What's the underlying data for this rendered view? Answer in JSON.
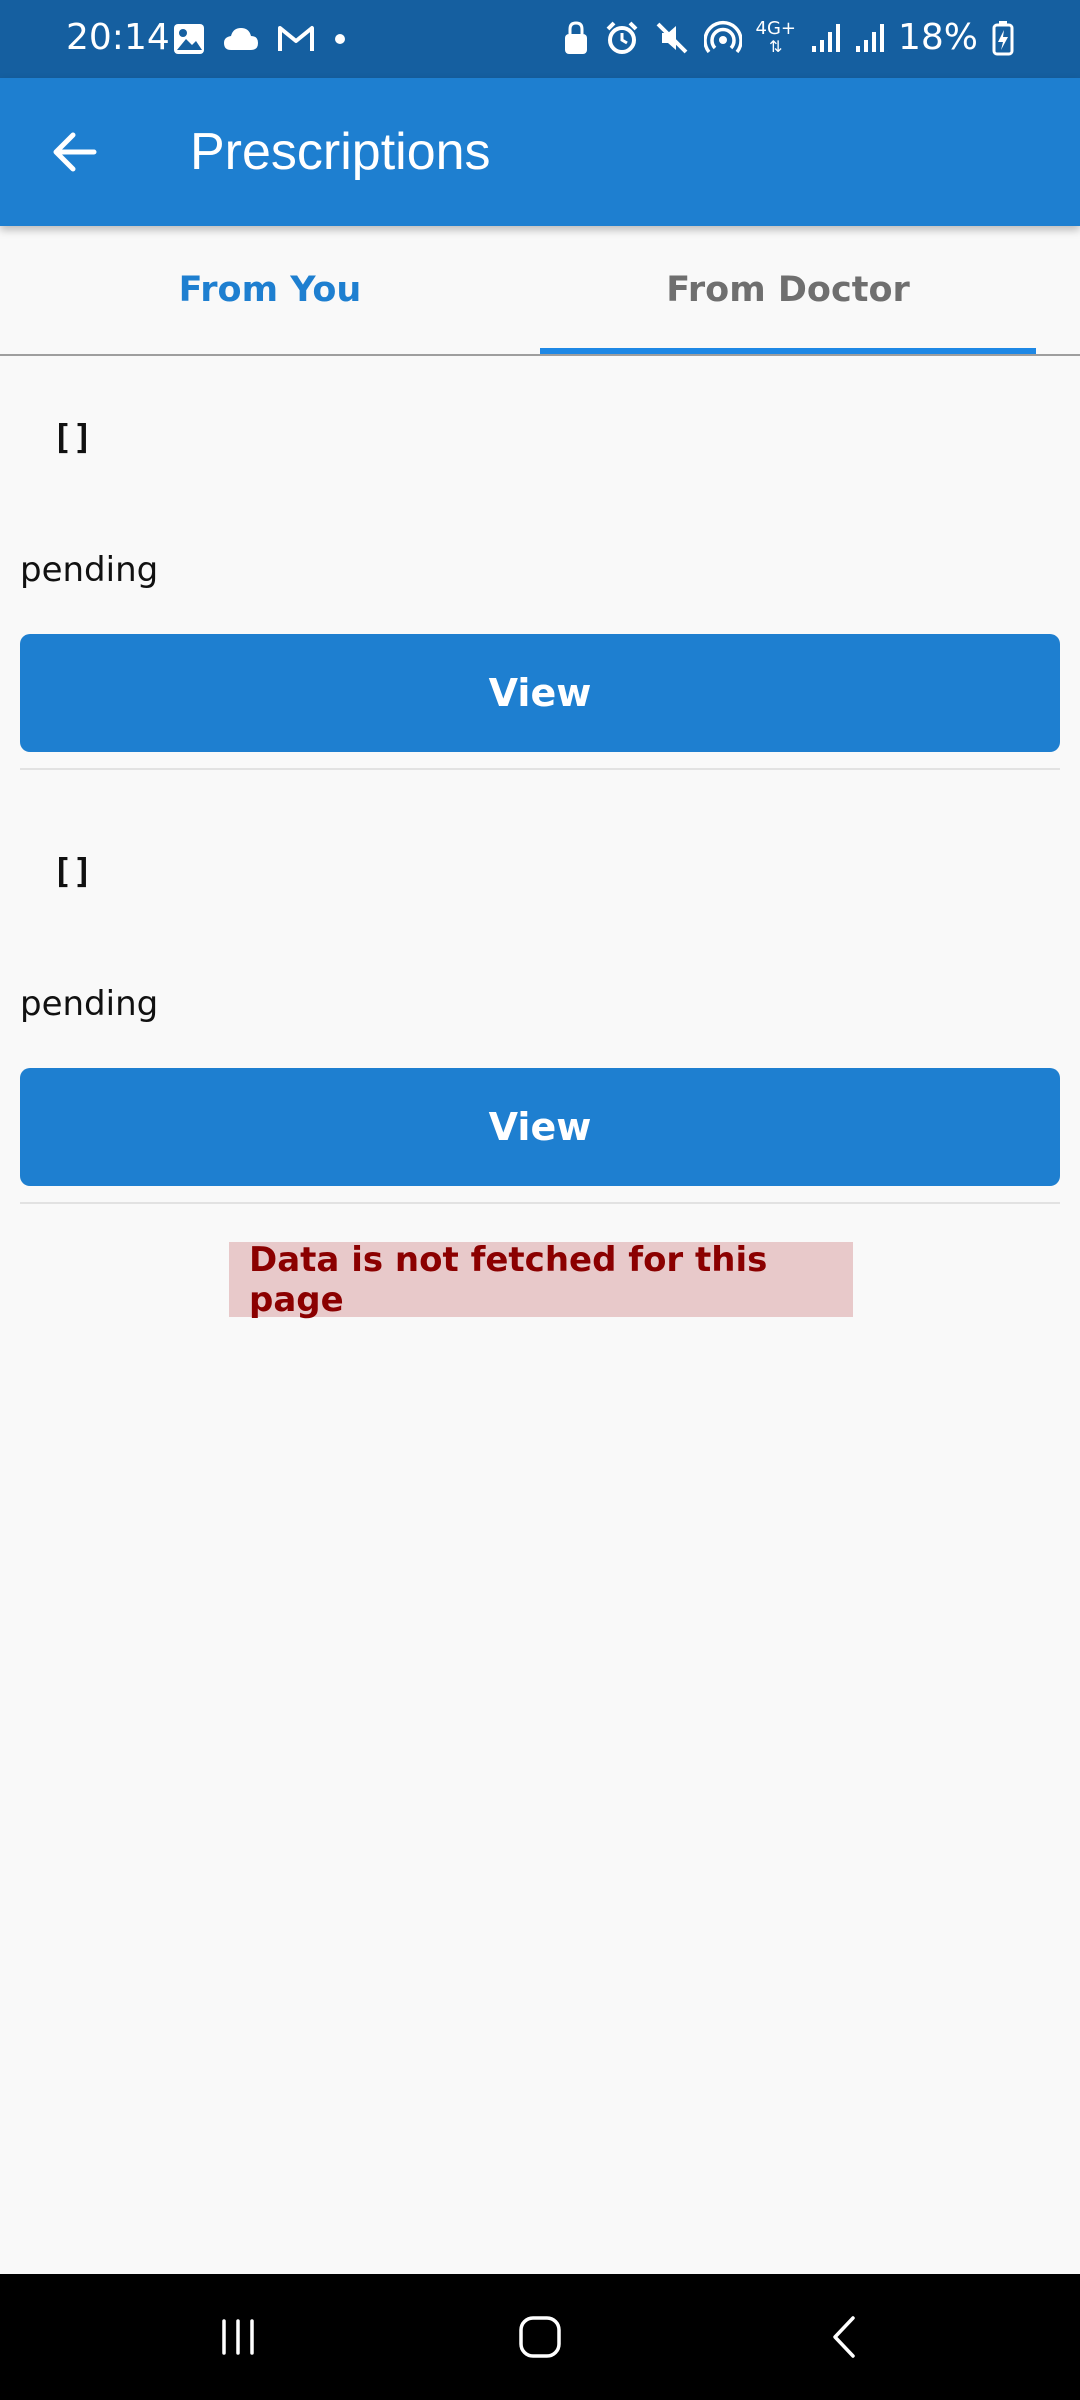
{
  "status_bar": {
    "time": "20:14",
    "battery": "18%",
    "left_icons": [
      "gallery-icon",
      "cloud-icon",
      "gmail-icon",
      "dot-icon"
    ],
    "right_icons": [
      "lock-icon",
      "alarm-icon",
      "mute-icon",
      "hotspot-icon",
      "4g-icon",
      "signal-icon",
      "signal-icon",
      "battery-charging-icon"
    ],
    "network_label": "4G+"
  },
  "app_bar": {
    "title": "Prescriptions",
    "back_icon": "arrow-left-icon",
    "background": "#1e7fd0"
  },
  "tabs": [
    {
      "label": "From You",
      "selected": false
    },
    {
      "label": "From Doctor",
      "selected": true
    }
  ],
  "prescriptions": [
    {
      "items": "[]",
      "status": "pending",
      "button_label": "View"
    },
    {
      "items": "[]",
      "status": "pending",
      "button_label": "View"
    }
  ],
  "error_message": "Data is not fetched for this page",
  "colors": {
    "accent": "#1e7fd0",
    "status_bar": "#155fa0",
    "error_text": "#8b0000",
    "error_bg": "#e8c9ca"
  },
  "nav_bar": {
    "icons": [
      "recents-icon",
      "home-icon",
      "back-icon"
    ]
  }
}
